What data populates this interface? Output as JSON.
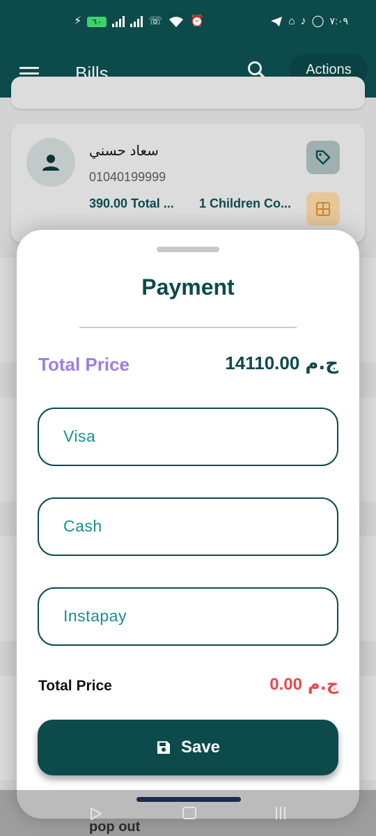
{
  "status_bar": {
    "battery": "٦٠",
    "time": "٧:٠٩",
    "icons_left": [
      "bolt-icon",
      "battery-icon",
      "signal-icon",
      "signal-icon",
      "volte-icon",
      "wifi-icon",
      "alarm-icon"
    ],
    "icons_right": [
      "telegram-icon",
      "notification-icon",
      "tiktok-icon",
      "whatsapp-icon"
    ]
  },
  "app_bar": {
    "title": "Bills",
    "actions_label": "Actions",
    "menu_icon": "menu-icon",
    "search_icon": "search-icon"
  },
  "background_list": {
    "card": {
      "name": "سعاد حسني",
      "phone": "01040199999",
      "total": "390.00 Total ...",
      "children": "1 Children Co..."
    },
    "peek_text": "pop out"
  },
  "payment_sheet": {
    "title": "Payment",
    "total_label": "Total Price",
    "total_value": "14110.00",
    "currency": "ج.م",
    "methods": [
      "Visa",
      "Cash",
      "Instapay"
    ],
    "sum_label": "Total Price",
    "sum_value": "0.00",
    "save_label": "Save"
  },
  "colors": {
    "primary": "#0c4a4c",
    "accent_teal": "#1a8f8a",
    "purple": "#9b7fe6",
    "red": "#e64a4f"
  }
}
